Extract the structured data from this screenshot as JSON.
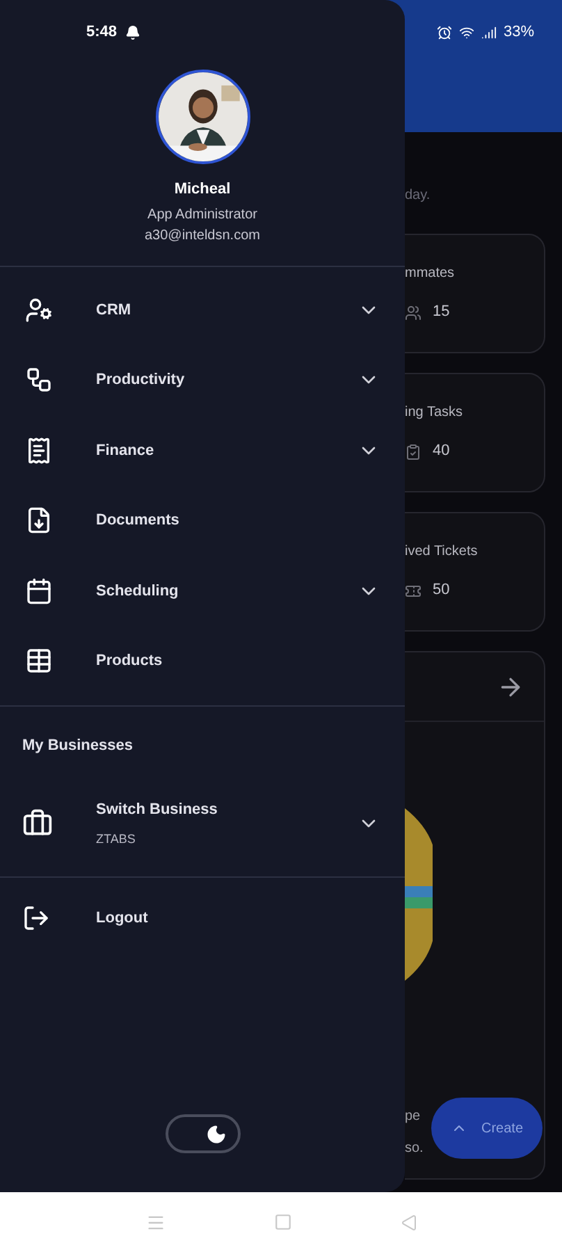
{
  "status_bar": {
    "time": "5:48",
    "battery": "33%"
  },
  "profile": {
    "name": "Micheal",
    "role": "App Administrator",
    "email": "a30@inteldsn.com"
  },
  "menu": [
    {
      "label": "CRM",
      "kind": "crm",
      "expandable": true
    },
    {
      "label": "Productivity",
      "kind": "productivity",
      "expandable": true
    },
    {
      "label": "Finance",
      "kind": "finance",
      "expandable": true
    },
    {
      "label": "Documents",
      "kind": "documents",
      "expandable": false
    },
    {
      "label": "Scheduling",
      "kind": "scheduling",
      "expandable": true
    },
    {
      "label": "Products",
      "kind": "products",
      "expandable": false
    }
  ],
  "businesses": {
    "heading": "My Businesses",
    "switch": {
      "label": "Switch Business",
      "value": "ZTABS",
      "expandable": true
    }
  },
  "logout": {
    "label": "Logout"
  },
  "theme_toggle": {
    "dark": true
  },
  "background": {
    "subtitle": "day.",
    "cards": [
      {
        "title": "mmates",
        "value": "15"
      },
      {
        "title": "ing Tasks",
        "value": "40"
      },
      {
        "title": "ived Tickets",
        "value": "50"
      }
    ],
    "chart_texts": [
      "pe",
      "so."
    ],
    "create_button": {
      "label": "Create"
    }
  }
}
